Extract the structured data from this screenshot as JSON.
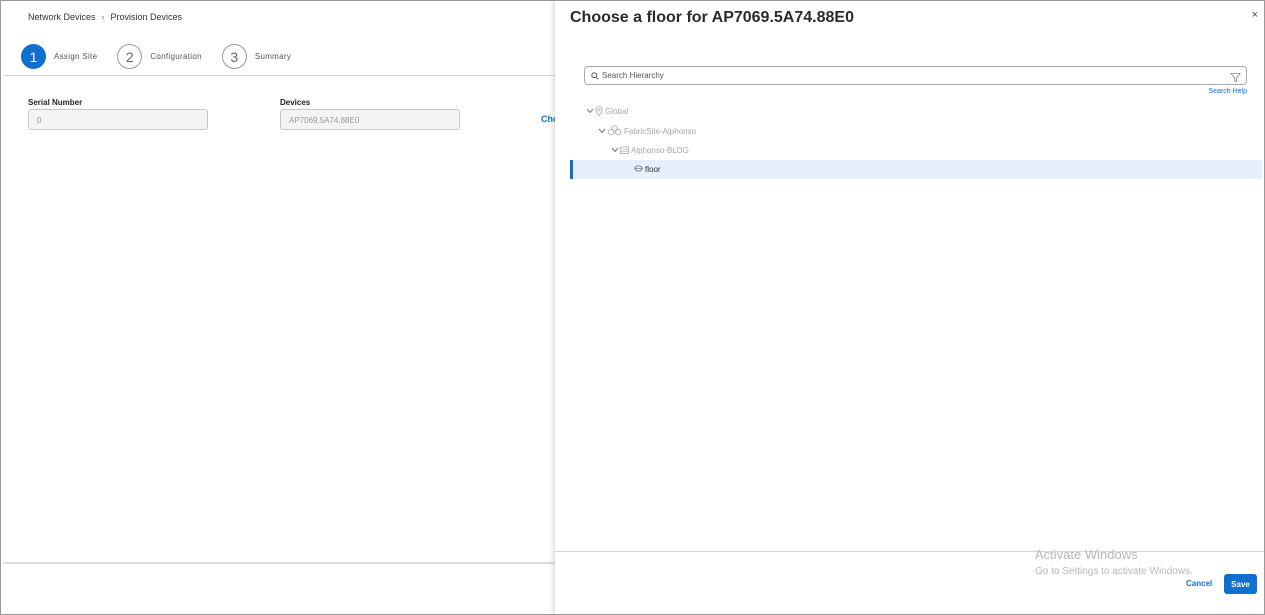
{
  "breadcrumb": {
    "items": [
      "Network Devices",
      "Provision Devices"
    ],
    "separator": ">"
  },
  "stepper": {
    "steps": [
      {
        "number": "1",
        "label": "Assign Site",
        "active": true
      },
      {
        "number": "2",
        "label": "Configuration",
        "active": false
      },
      {
        "number": "3",
        "label": "Summary",
        "active": false
      }
    ]
  },
  "form": {
    "serial_label": "Serial Number",
    "serial_value": "0",
    "devices_label": "Devices",
    "devices_value": "AP7069.5A74.88E0",
    "choose_link": "Cho"
  },
  "drawer": {
    "title": "Choose a floor for AP7069.5A74.88E0",
    "close": "×",
    "search_placeholder": "Search Hierarchy",
    "search_help": "Search Help",
    "tree": [
      {
        "label": "Global",
        "icon": "location-pin-icon",
        "expanded": true
      },
      {
        "label": "FabricSite-Alphonso",
        "icon": "fabric-site-icon",
        "expanded": true
      },
      {
        "label": "Alphonso-BLDG",
        "icon": "building-icon",
        "expanded": true
      },
      {
        "label": "floor",
        "icon": "floor-icon",
        "selected": true
      }
    ],
    "cancel_label": "Cancel",
    "save_label": "Save"
  },
  "watermark": {
    "line1": "Activate Windows",
    "line2": "Go to Settings to activate Windows."
  },
  "colors": {
    "accent": "#1170cf",
    "selected_row": "#e6effb"
  }
}
